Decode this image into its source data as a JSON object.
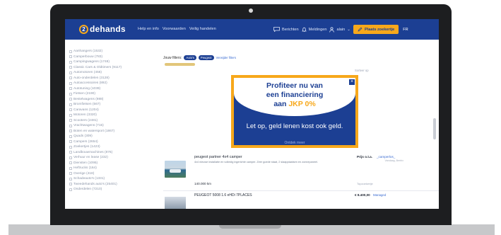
{
  "header": {
    "logo_symbol": "2",
    "logo_text": "dehands",
    "nav_links": [
      "Help en info",
      "Voorwaarden",
      "Veilig handelen"
    ],
    "messages": "Berichten",
    "notifications": "Meldingen",
    "user": "alain",
    "place_ad": "Plaats zoekertje",
    "language": "FR",
    "accent_color": "#f7a81b",
    "brand_color": "#1c3f93"
  },
  "sidebar": {
    "categories": [
      "Aanhangers (1532)",
      "Camperbouw (783)",
      "Campingwagens (1748)",
      "Classic Cars & Oldtimers (9117)",
      "Automotoren (456)",
      "Auto-onderdelen (3128)",
      "Autoaccessoires (892)",
      "Autotuning (1039)",
      "Fietsen (2190)",
      "Bestelwagens (988)",
      "Bromfietsen (567)",
      "Caravans (1204)",
      "Motoren (3320)",
      "Scooters (2481)",
      "Vrachtwagens (715)",
      "Boten en watersport (1867)",
      "Quads (309)",
      "Campers (2654)",
      "Zoekertjes (1423)",
      "Landbouwmachines (876)",
      "Verhuur en lease (232)",
      "Diensten (1095)",
      "Heftrucks (164)",
      "Overige (418)",
      "Schadeauto's (1331)",
      "Tweedehands auto's (25401)",
      "Onderdelen (7210)"
    ]
  },
  "filters": {
    "label": "Jouw filters:",
    "chips": [
      "Auto's",
      "Peugeot"
    ],
    "clear": "Verwijder filters",
    "right_label": "Sorteer op"
  },
  "modal": {
    "line1": "Profiteer nu van",
    "line2": "een financiering",
    "line3_prefix": "aan",
    "line3_highlight": "JKP 0%",
    "disclaimer": "Let op, geld lenen kost ook geld.",
    "more": "Ontdek meer",
    "close": "×"
  },
  "listing1": {
    "title": "peugeot partner 4x4 camper",
    "desc": "4x4 nieuwe installatie en volledig ingerichte camper. Zeer goede staat, 2 slaapplaatsen en zonnepaneel.",
    "price": "Prijs o.t.a.",
    "seller": "_camperlos_",
    "extra": "Vandaag, Bertrix",
    "km": "140.000 km",
    "sub": "Topzoekertje"
  },
  "listing2": {
    "title": "PEUGEOT 5008 1.6 eHDi 7PLACES",
    "price": "€ 8.400,00",
    "tag": "Managed"
  }
}
